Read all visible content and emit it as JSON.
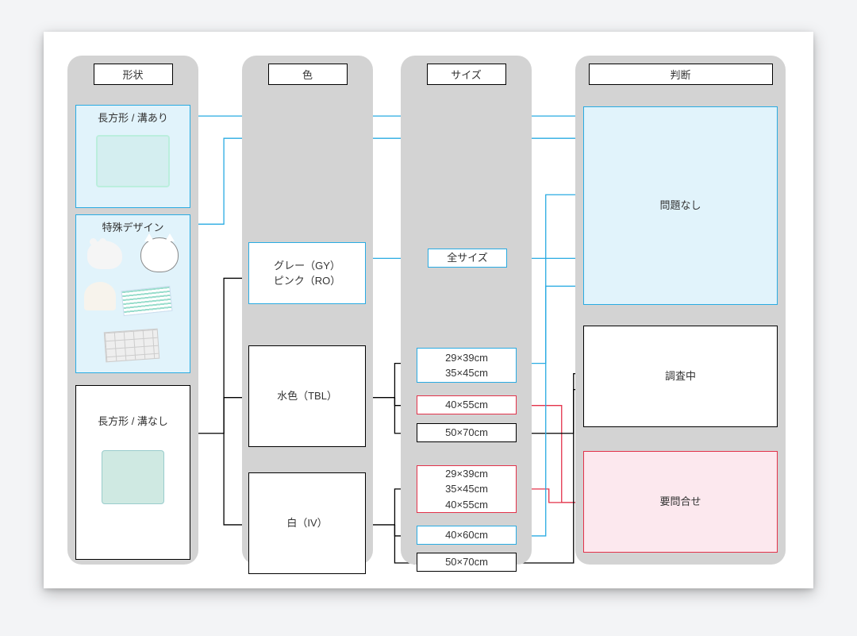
{
  "columns": {
    "shape": "形状",
    "color": "色",
    "size": "サイズ",
    "decision": "判断"
  },
  "shapes": {
    "rectGroove": "長方形 / 溝あり",
    "special": "特殊デザイン",
    "rectPlain": "長方形 / 溝なし"
  },
  "colors": {
    "grey": "グレー（GY）",
    "pink": "ピンク（RO）",
    "lightBlue": "水色（TBL）",
    "white": "白（IV）"
  },
  "sizes": {
    "all": "全サイズ",
    "tbl_a1": "29×39cm",
    "tbl_a2": "35×45cm",
    "tbl_b": "40×55cm",
    "tbl_c": "50×70cm",
    "iv_a1": "29×39cm",
    "iv_a2": "35×45cm",
    "iv_a3": "40×55cm",
    "iv_b": "40×60cm",
    "iv_c": "50×70cm"
  },
  "decisions": {
    "ok": "問題なし",
    "investigating": "調査中",
    "contact": "要問合せ"
  },
  "style": {
    "accentBlue": "#29abe2",
    "fillBlue": "#e1f3fb",
    "accentRed": "#e3324a",
    "fillPink": "#fce8ee",
    "black": "#000000",
    "columnBg": "#d3d3d3"
  }
}
